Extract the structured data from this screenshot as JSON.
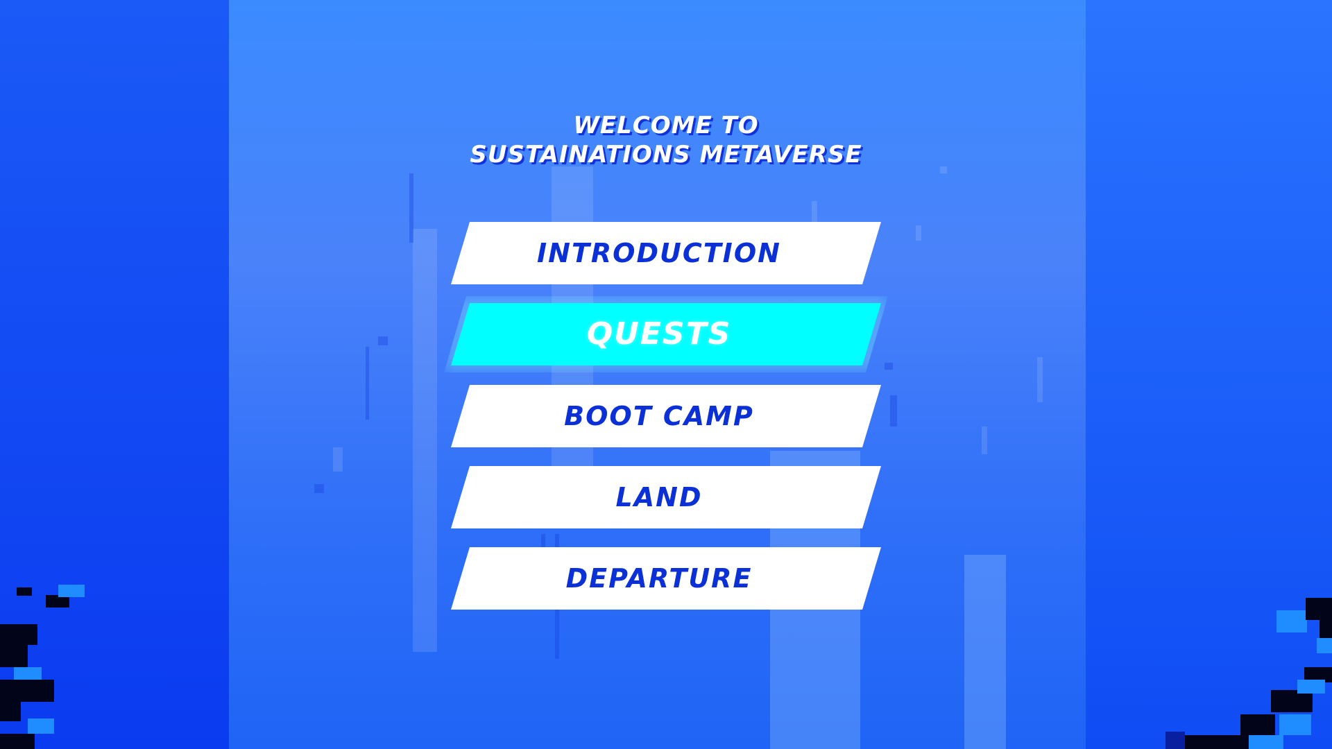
{
  "title": {
    "line1": "WELCOME TO",
    "line2": "SUSTAINATIONS METAVERSE"
  },
  "menu": {
    "items": [
      {
        "label": "INTRODUCTION",
        "selected": false
      },
      {
        "label": "QUESTS",
        "selected": true
      },
      {
        "label": "BOOT CAMP",
        "selected": false
      },
      {
        "label": "LAND",
        "selected": false
      },
      {
        "label": "DEPARTURE",
        "selected": false
      }
    ]
  },
  "colors": {
    "background": "#3f82ff",
    "button": "#ffffff",
    "button_selected": "#00ffff",
    "button_text": "#0b30d6",
    "button_text_selected": "#ffffff"
  }
}
